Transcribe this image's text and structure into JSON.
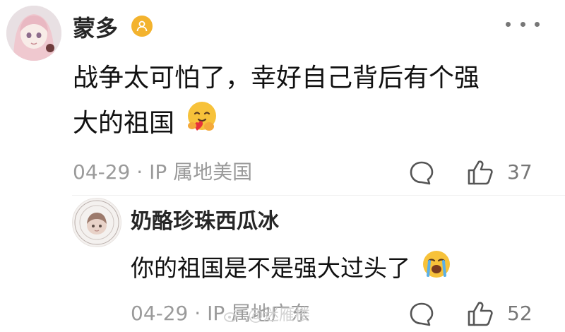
{
  "comment": {
    "username": "蒙多",
    "text_line1": "战争太可怕了，幸好自己背后有个强",
    "text_line2": "大的祖国",
    "date": "04-29",
    "location": "IP 属地美国",
    "like_count": "37",
    "emoji": "hugging-face-emoji"
  },
  "reply": {
    "username": "奶酪珍珠西瓜冰",
    "text": "你的祖国是不是强大过头了",
    "date": "04-29",
    "location": "IP 属地广东",
    "like_count": "52",
    "emoji": "loudly-crying-face-emoji"
  },
  "watermark": {
    "text": "@迷雁楼"
  },
  "colors": {
    "badge": "#f3b32e",
    "meta_text": "#9a9a9a",
    "emoji_yellow": "#f7c23a",
    "heart_red": "#e8323a"
  }
}
